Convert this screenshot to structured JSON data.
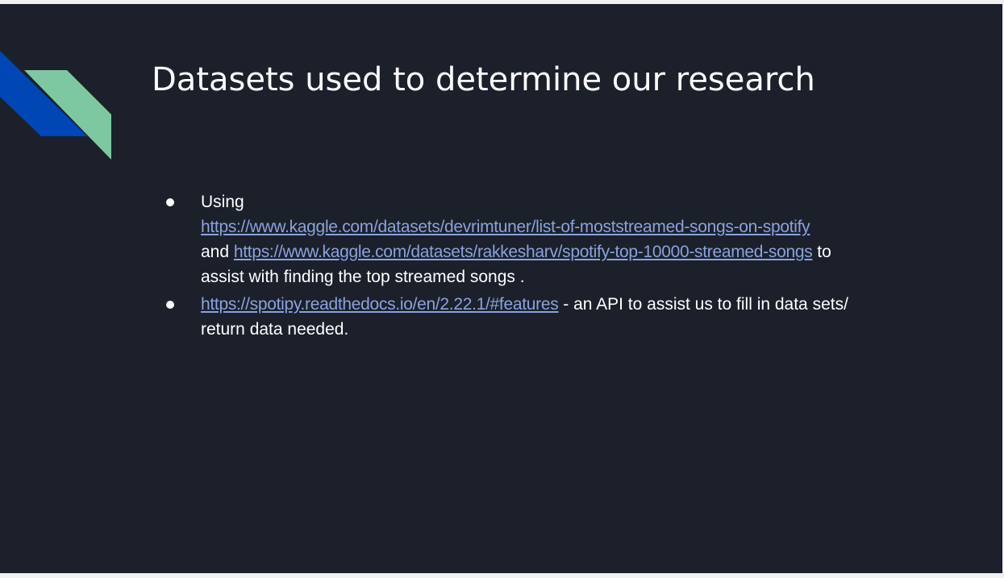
{
  "slide": {
    "title": "Datasets used to determine our research",
    "bullets": [
      {
        "prefix": "Using",
        "link_1": "https://www.kaggle.com/datasets/devrimtuner/list-of-moststreamed-songs-on-spotify",
        "connector": "and",
        "link_2": "https://www.kaggle.com/datasets/rakkesharv/spotify-top-10000-streamed-songs",
        "suffix_1": "to",
        "suffix_2": "assist with finding the top streamed songs ."
      },
      {
        "link": "https://spotipy.readthedocs.io/en/2.22.1/#features",
        "text_1": " - an API to assist us to fill in data sets/",
        "text_2": "return data needed."
      }
    ]
  },
  "colors": {
    "background": "#1b202b",
    "text": "#ffffff",
    "link": "#8aa2dd",
    "accent_blue": "#0046b4",
    "accent_green": "#7dc8a0"
  }
}
